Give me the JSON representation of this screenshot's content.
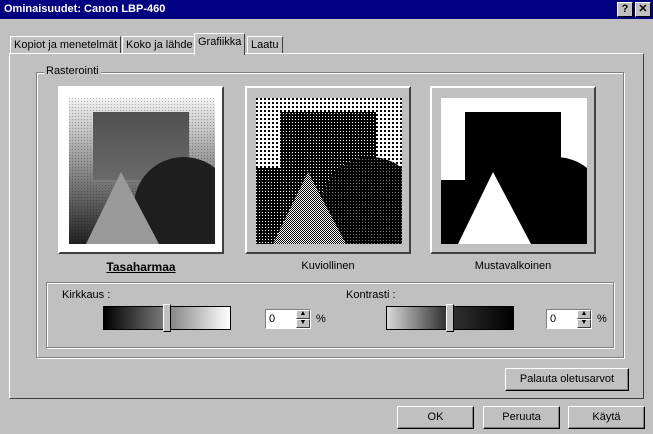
{
  "window": {
    "title": "Ominaisuudet: Canon LBP-460",
    "help_glyph": "?",
    "close_glyph": "✕"
  },
  "tabs": [
    {
      "label": "Kopiot ja menetelmät",
      "active": false
    },
    {
      "label": "Koko ja lähde",
      "active": false
    },
    {
      "label": "Grafiikka",
      "active": true
    },
    {
      "label": "Laatu",
      "active": false
    }
  ],
  "raster": {
    "group_title": "Rasterointi",
    "options": [
      {
        "label": "Tasaharmaa",
        "selected": true
      },
      {
        "label": "Kuviollinen",
        "selected": false
      },
      {
        "label": "Mustavalkoinen",
        "selected": false
      }
    ]
  },
  "brightness": {
    "label": "Kirkkaus :",
    "value": "0",
    "unit": "%",
    "level": 0.5
  },
  "contrast": {
    "label": "Kontrasti :",
    "value": "0",
    "unit": "%",
    "level": 0.5
  },
  "buttons": {
    "reset": "Palauta oletusarvot",
    "ok": "OK",
    "cancel": "Peruuta",
    "apply": "Käytä"
  },
  "icons": {
    "spin_up": "spin-up-arrow-icon",
    "spin_down": "spin-down-arrow-icon"
  }
}
